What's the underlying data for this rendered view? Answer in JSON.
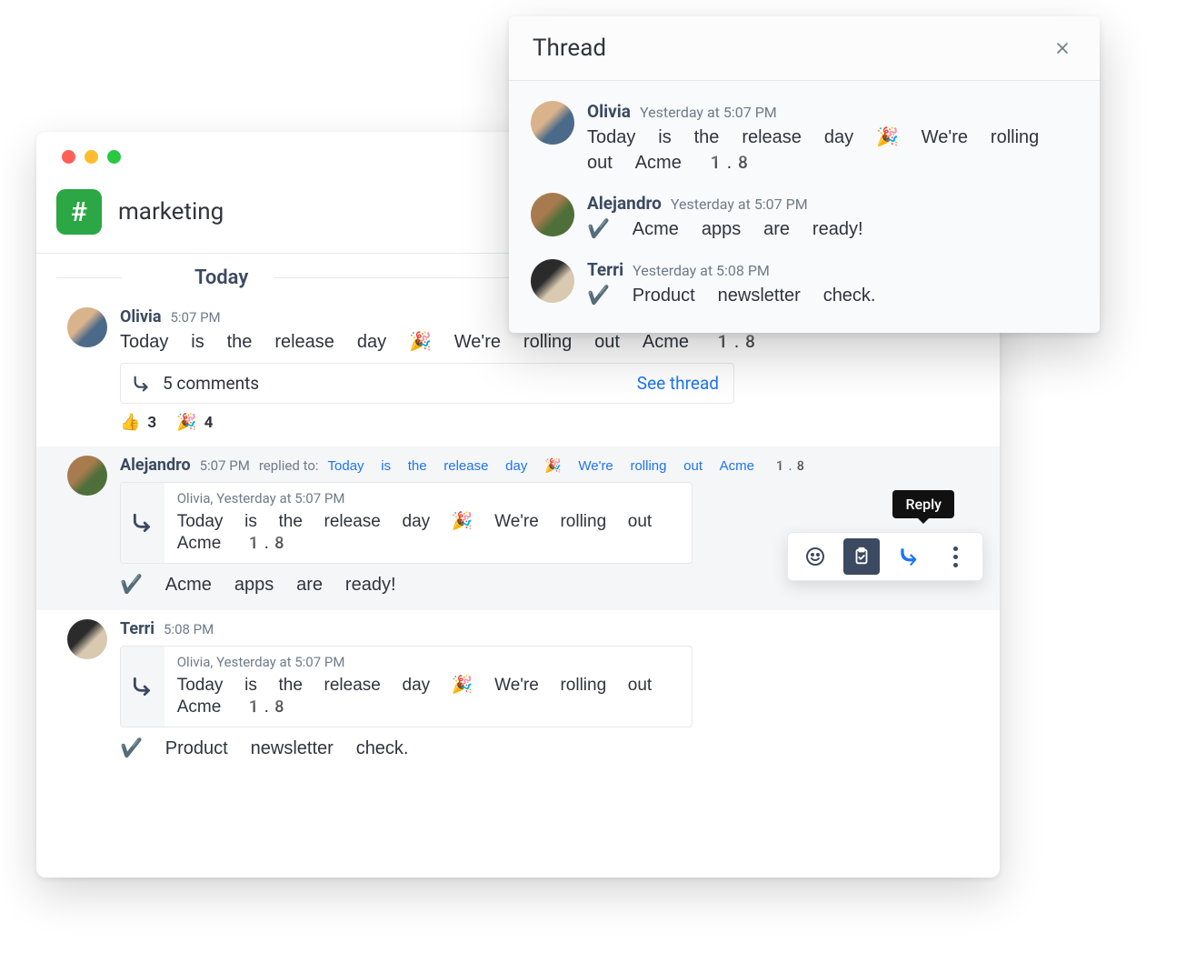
{
  "channel": {
    "hash_symbol": "#",
    "name": "marketing"
  },
  "divider": {
    "today": "Today"
  },
  "messages": {
    "m1": {
      "author": "Olivia",
      "time": "5:07 PM",
      "text": "Today is the release day 🎉 We're rolling out Acme 1.8",
      "thread_count_label": "5 comments",
      "see_thread": "See thread",
      "reactions": {
        "r1": {
          "emoji": "👍",
          "count": "3"
        },
        "r2": {
          "emoji": "🎉",
          "count": "4"
        }
      }
    },
    "m2": {
      "author": "Alejandro",
      "time": "5:07 PM",
      "replied_label": "replied to:",
      "replied_link": "Today is the release day 🎉 We're rolling out Acme 1.8",
      "quote_meta": "Olivia, Yesterday at 5:07 PM",
      "quote_text": "Today is the release day 🎉 We're rolling out Acme 1.8",
      "reply_text": "✔️ Acme apps are ready!"
    },
    "m3": {
      "author": "Terri",
      "time": "5:08 PM",
      "quote_meta": "Olivia, Yesterday at 5:07 PM",
      "quote_text": "Today is the release day 🎉 We're rolling out Acme 1.8",
      "reply_text": "✔️ Product newsletter check."
    }
  },
  "hover_toolbar": {
    "tooltip": "Reply"
  },
  "thread_panel": {
    "title": "Thread",
    "messages": {
      "t1": {
        "author": "Olivia",
        "time": "Yesterday at 5:07 PM",
        "text": "Today is the release day 🎉 We're rolling out Acme 1.8"
      },
      "t2": {
        "author": "Alejandro",
        "time": "Yesterday at 5:07 PM",
        "text": "✔️ Acme apps are ready!"
      },
      "t3": {
        "author": "Terri",
        "time": "Yesterday at 5:08 PM",
        "text": "✔️ Product newsletter check."
      }
    }
  }
}
